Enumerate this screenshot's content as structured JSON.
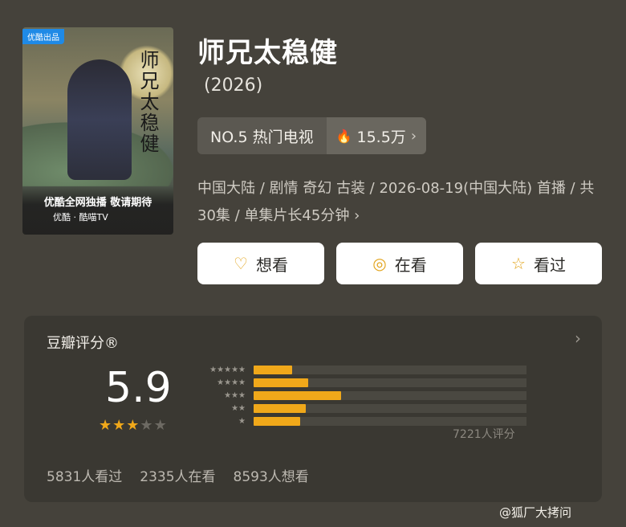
{
  "poster": {
    "badge": "优酷出品",
    "vertical_title": "师兄太稳健",
    "slogan": "优酷全网独播 敬请期待",
    "brands": "优酷 · 酷喵TV"
  },
  "title": "师兄太稳健",
  "year": "(2026)",
  "rank": {
    "label": "NO.5 热门电视",
    "heat": "15.5万"
  },
  "meta": "中国大陆 / 剧情 奇幻 古装 / 2026-08-19(中国大陆) 首播 / 共30集 / 单集片长45分钟",
  "actions": [
    {
      "label": "想看",
      "icon": "heart-plus-icon"
    },
    {
      "label": "在看",
      "icon": "target-icon"
    },
    {
      "label": "看过",
      "icon": "star-outline-icon"
    }
  ],
  "rating": {
    "title": "豆瓣评分®",
    "score": "5.9",
    "stars": 3,
    "distribution": [
      {
        "stars": 5,
        "fraction": 0.14
      },
      {
        "stars": 4,
        "fraction": 0.2
      },
      {
        "stars": 3,
        "fraction": 0.32
      },
      {
        "stars": 2,
        "fraction": 0.19
      },
      {
        "stars": 1,
        "fraction": 0.17
      }
    ],
    "count": "7221人评分",
    "watched": "5831人看过",
    "watching": "2335人在看",
    "want": "8593人想看"
  },
  "watermark": "@狐厂大拷问",
  "colors": {
    "accent": "#f0a81a",
    "background": "#45423b",
    "card": "#3a3832"
  }
}
